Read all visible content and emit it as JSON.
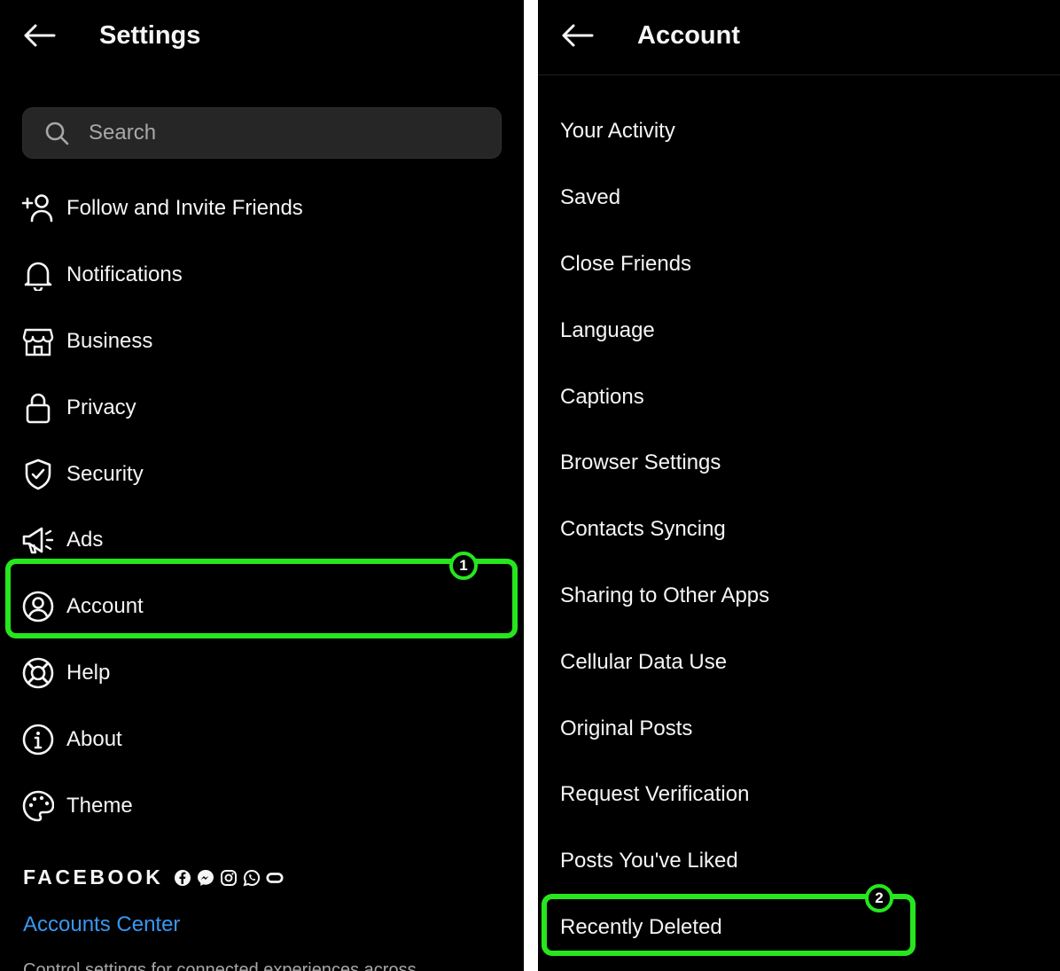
{
  "left_panel": {
    "title": "Settings",
    "search_placeholder": "Search",
    "items": [
      {
        "label": "Follow and Invite Friends",
        "icon": "add-person-icon"
      },
      {
        "label": "Notifications",
        "icon": "bell-icon"
      },
      {
        "label": "Business",
        "icon": "storefront-icon"
      },
      {
        "label": "Privacy",
        "icon": "lock-icon"
      },
      {
        "label": "Security",
        "icon": "shield-check-icon"
      },
      {
        "label": "Ads",
        "icon": "megaphone-icon"
      },
      {
        "label": "Account",
        "icon": "account-circle-icon"
      },
      {
        "label": "Help",
        "icon": "lifebuoy-icon"
      },
      {
        "label": "About",
        "icon": "info-icon"
      },
      {
        "label": "Theme",
        "icon": "palette-icon"
      }
    ],
    "facebook_label": "FACEBOOK",
    "accounts_center": "Accounts Center",
    "accounts_center_desc": "Control settings for connected experiences across"
  },
  "right_panel": {
    "title": "Account",
    "items": [
      "Your Activity",
      "Saved",
      "Close Friends",
      "Language",
      "Captions",
      "Browser Settings",
      "Contacts Syncing",
      "Sharing to Other Apps",
      "Cellular Data Use",
      "Original Posts",
      "Request Verification",
      "Posts You've Liked",
      "Recently Deleted"
    ]
  },
  "annotations": {
    "step_1": "1",
    "step_2": "2",
    "highlight_color": "#26e61e"
  },
  "colors": {
    "background": "#000000",
    "text": "#f5f5f5",
    "link": "#3897f0",
    "search_bg": "#262626"
  }
}
